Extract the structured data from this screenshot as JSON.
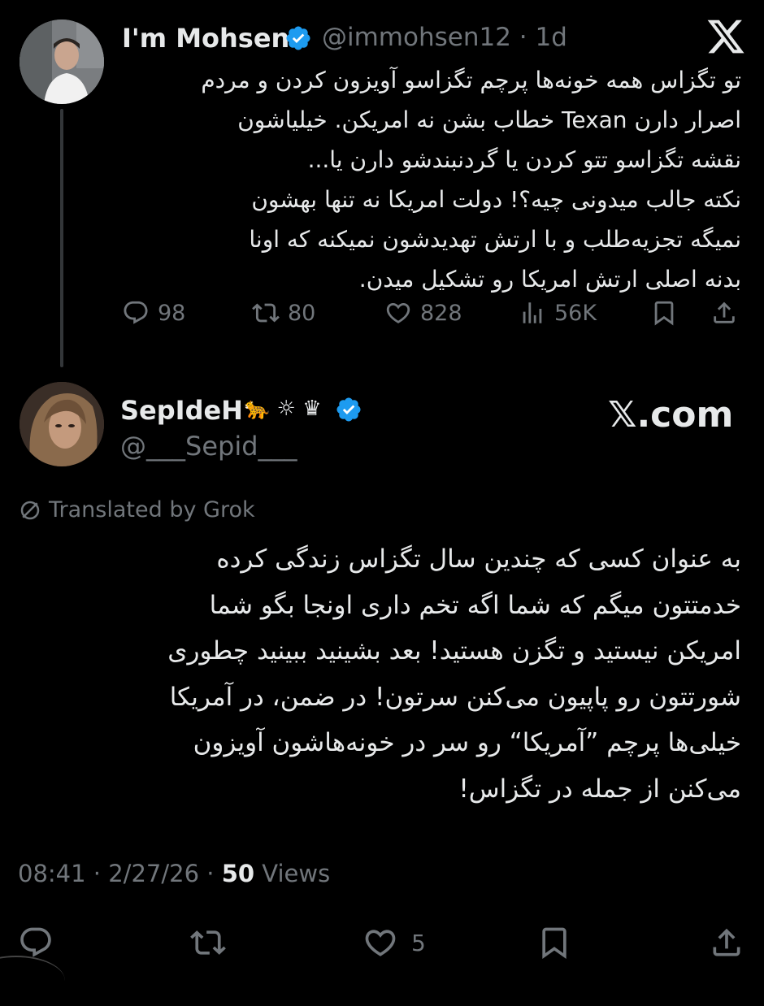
{
  "reply_to": {
    "name": "I'm Mohsen",
    "handle": "@immohsen12",
    "time": "1d",
    "text_lines": [
      "تو تگزاس همه خونه‌ها پرچم تگزاسو آویزون کردن و مردم",
      "اصرار دارن Texan خطاب بشن نه امریکن. خیلیاشون",
      "نقشه تگزاسو تتو کردن یا گردنبندشو دارن یا...",
      "نکته جالب میدونی چیه؟! دولت امریکا نه تنها بهشون",
      "نمیگه تجزیه‌طلب و با ارتش تهدیدشون نمیکنه که اونا",
      "بدنه اصلی ارتش امریکا رو تشکیل میدن."
    ],
    "stats": {
      "replies": "98",
      "reposts": "80",
      "likes": "828",
      "views": "56K"
    }
  },
  "tweet": {
    "name": "SepIdeH",
    "name_emojis": "🐆 ☼ ♛",
    "handle": "@___Sepid___",
    "brand": "𝕏.com",
    "translated_label": "Translated by Grok",
    "text_lines": [
      "به عنوان کسی که چندین سال تگزاس زندگی کرده",
      "خدمتتون میگم که شما اگه تخم داری اونجا بگو شما",
      "امریکن نیستید و تگزن هستید! بعد بشینید ببینید چطوری",
      "شورتتون رو پاپیون می‌کنن سرتون! در ضمن، در آمریکا",
      "خیلی‌ها پرچم ”آمریکا“ رو سر در خونه‌هاشون آویزون",
      "می‌کنن از جمله در تگزاس!"
    ],
    "time": "08:41",
    "date": "2/27/26",
    "views_count": "50",
    "views_label": "Views",
    "stats": {
      "likes": "5"
    }
  },
  "colors": {
    "background": "#000000",
    "text": "#e7e9ea",
    "muted": "#71767b",
    "verified": "#1d9bf0"
  },
  "icons": [
    "x-logo-icon",
    "verified-badge-icon",
    "reply-icon",
    "repost-icon",
    "like-icon",
    "views-icon",
    "bookmark-icon",
    "share-icon",
    "translate-icon"
  ]
}
